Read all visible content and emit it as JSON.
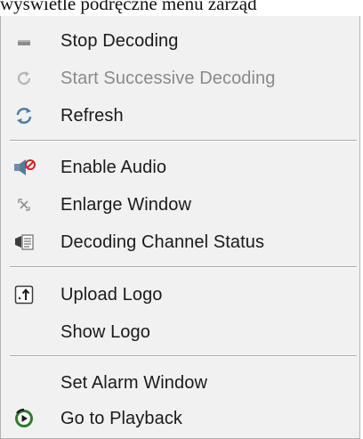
{
  "caption": "wyświetle podręczne menu zarząd",
  "menu": {
    "items": [
      {
        "label": "Stop Decoding",
        "icon": "stop-decoding-icon",
        "disabled": false
      },
      {
        "label": "Start Successive Decoding",
        "icon": "start-successive-decoding-icon",
        "disabled": true
      },
      {
        "label": "Refresh",
        "icon": "refresh-icon",
        "disabled": false
      },
      {
        "label": "Enable Audio",
        "icon": "speaker-muted-icon",
        "disabled": false
      },
      {
        "label": "Enlarge Window",
        "icon": "enlarge-window-icon",
        "disabled": false
      },
      {
        "label": "Decoding Channel Status",
        "icon": "channel-status-icon",
        "disabled": false
      },
      {
        "label": "Upload Logo",
        "icon": "upload-logo-icon",
        "disabled": false
      },
      {
        "label": "Show Logo",
        "icon": "",
        "disabled": false
      },
      {
        "label": "Set Alarm Window",
        "icon": "",
        "disabled": false
      },
      {
        "label": "Go to Playback",
        "icon": "playback-icon",
        "disabled": false
      }
    ]
  }
}
